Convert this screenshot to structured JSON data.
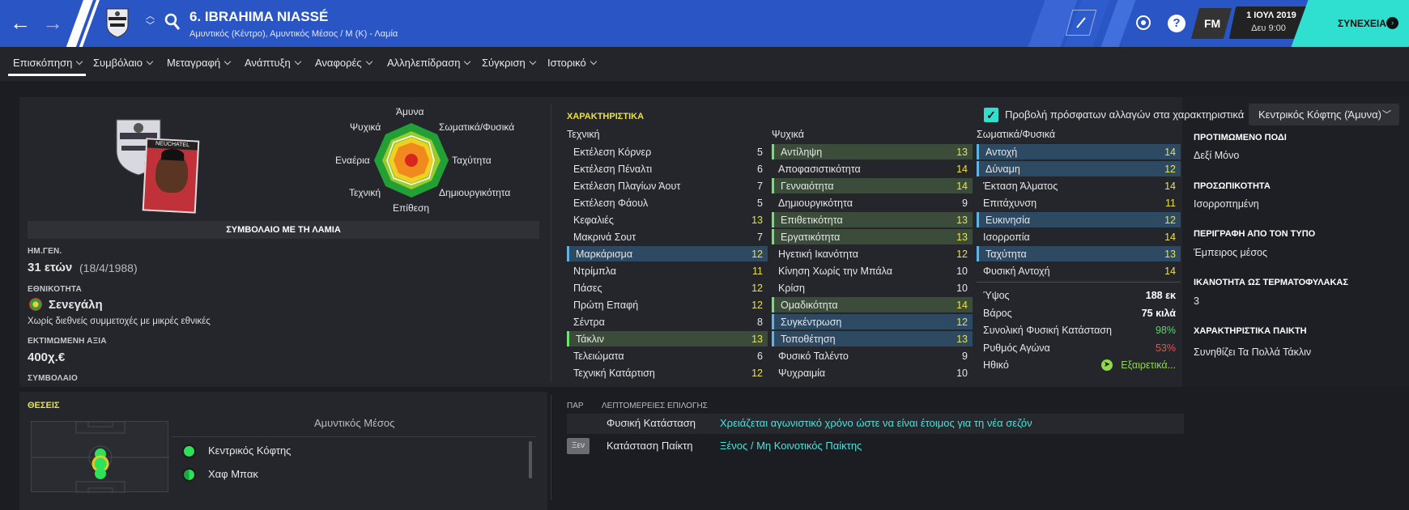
{
  "header": {
    "title": "6. IBRAHIMA NIASSÉ",
    "subtitle": "Αμυντικός (Κέντρο), Αμυντικός Μέσος / Μ (Κ) - Λαμία",
    "fm_label": "FM",
    "date": "1 ΙΟΥΛ 2019",
    "time": "Δευ 9:00",
    "continue_label": "ΣΥΝΕΧΕΙΑ"
  },
  "menu": [
    "Επισκόπηση",
    "Συμβόλαιο",
    "Μεταγραφή",
    "Ανάπτυξη",
    "Αναφορές",
    "Αλληλεπίδραση",
    "Σύγκριση",
    "Ιστορικό"
  ],
  "profile": {
    "radar_labels": {
      "top": "Άμυνα",
      "top_left": "Ψυχικά",
      "top_right": "Σωματικά/Φυσικά",
      "left": "Εναέρια",
      "right": "Ταχύτητα",
      "bottom_left": "Τεχνική",
      "bottom_right": "Δημιουργικότητα",
      "bottom": "Επίθεση"
    },
    "badge_text": "NEUCHATEL",
    "contract_banner": "ΣΥΜΒΟΛΑΙΟ ΜΕ ΤΗ ΛΑΜΙΑ",
    "dob_label": "ΗΜ.ΓΕΝ.",
    "age": "31 ετών",
    "dob": "(18/4/1988)",
    "nationality_label": "ΕΘΝΙΚΟΤΗΤΑ",
    "nationality": "Σενεγάλη",
    "intl_note": "Χωρίς διεθνείς συμμετοχές με μικρές εθνικές",
    "value_label": "ΕΚΤΙΜΩΜΕΝΗ ΑΞΙΑ",
    "value": "400χ.€",
    "contract_label": "ΣΥΜΒΟΛΑΙΟ"
  },
  "attributes": {
    "heading": "ΧΑΡΑΚΤΗΡΙΣΤΙΚΑ",
    "show_changes_label": "Προβολή πρόσφατων αλλαγών στα χαρακτηριστικά",
    "role_select": "Κεντρικός Κόφτης (Άμυνα)",
    "technical_header": "Τεχνική",
    "mental_header": "Ψυχικά",
    "physical_header": "Σωματικά/Φυσικά",
    "technical": [
      {
        "name": "Εκτέλεση Κόρνερ",
        "value": "5",
        "hl": ""
      },
      {
        "name": "Εκτέλεση Πέναλτι",
        "value": "6",
        "hl": ""
      },
      {
        "name": "Εκτέλεση Πλαγίων Άουτ",
        "value": "7",
        "hl": ""
      },
      {
        "name": "Εκτέλεση Φάουλ",
        "value": "5",
        "hl": ""
      },
      {
        "name": "Κεφαλιές",
        "value": "13",
        "hl": ""
      },
      {
        "name": "Μακρινά Σουτ",
        "value": "7",
        "hl": ""
      },
      {
        "name": "Μαρκάρισμα",
        "value": "12",
        "hl": "blue"
      },
      {
        "name": "Ντρίμπλα",
        "value": "11",
        "hl": ""
      },
      {
        "name": "Πάσες",
        "value": "12",
        "hl": ""
      },
      {
        "name": "Πρώτη Επαφή",
        "value": "12",
        "hl": ""
      },
      {
        "name": "Σέντρα",
        "value": "8",
        "hl": ""
      },
      {
        "name": "Τάκλιν",
        "value": "13",
        "hl": "green"
      },
      {
        "name": "Τελειώματα",
        "value": "6",
        "hl": ""
      },
      {
        "name": "Τεχνική Κατάρτιση",
        "value": "12",
        "hl": ""
      }
    ],
    "mental": [
      {
        "name": "Αντίληψη",
        "value": "13",
        "hl": "green"
      },
      {
        "name": "Αποφασιστικότητα",
        "value": "14",
        "hl": ""
      },
      {
        "name": "Γενναιότητα",
        "value": "14",
        "hl": "green"
      },
      {
        "name": "Δημιουργικότητα",
        "value": "9",
        "hl": ""
      },
      {
        "name": "Επιθετικότητα",
        "value": "13",
        "hl": "green"
      },
      {
        "name": "Εργατικότητα",
        "value": "13",
        "hl": "green"
      },
      {
        "name": "Ηγετική Ικανότητα",
        "value": "12",
        "hl": ""
      },
      {
        "name": "Κίνηση Χωρίς την Μπάλα",
        "value": "10",
        "hl": ""
      },
      {
        "name": "Κρίση",
        "value": "10",
        "hl": ""
      },
      {
        "name": "Ομαδικότητα",
        "value": "14",
        "hl": "green"
      },
      {
        "name": "Συγκέντρωση",
        "value": "12",
        "hl": "blue"
      },
      {
        "name": "Τοποθέτηση",
        "value": "13",
        "hl": "blue"
      },
      {
        "name": "Φυσικό Ταλέντο",
        "value": "9",
        "hl": ""
      },
      {
        "name": "Ψυχραιμία",
        "value": "10",
        "hl": ""
      }
    ],
    "physical": [
      {
        "name": "Αντοχή",
        "value": "14",
        "hl": "blue"
      },
      {
        "name": "Δύναμη",
        "value": "12",
        "hl": "blue"
      },
      {
        "name": "Έκταση Άλματος",
        "value": "14",
        "hl": ""
      },
      {
        "name": "Επιτάχυνση",
        "value": "11",
        "hl": ""
      },
      {
        "name": "Ευκινησία",
        "value": "12",
        "hl": "blue"
      },
      {
        "name": "Ισορροπία",
        "value": "14",
        "hl": ""
      },
      {
        "name": "Ταχύτητα",
        "value": "13",
        "hl": "blue"
      },
      {
        "name": "Φυσική Αντοχή",
        "value": "14",
        "hl": ""
      }
    ],
    "extras": [
      {
        "name": "Ύψος",
        "value": "188 εκ",
        "color": "#ffffff"
      },
      {
        "name": "Βάρος",
        "value": "75 κιλά",
        "color": "#ffffff"
      },
      {
        "name": "Συνολική Φυσική Κατάσταση",
        "value": "98%",
        "color": "#5fd36a"
      },
      {
        "name": "Ρυθμός Αγώνα",
        "value": "53%",
        "color": "#e0584a"
      },
      {
        "name": "Ηθικό",
        "value": "Εξαιρετικά...",
        "color": "#8fd94a"
      }
    ]
  },
  "side": {
    "foot_label": "ΠΡΟΤΙΜΩΜΕΝΟ ΠΟΔΙ",
    "foot": "Δεξί Μόνο",
    "personality_label": "ΠΡΟΣΩΠΙΚΟΤΗΤΑ",
    "personality": "Ισορροπημένη",
    "media_label": "ΠΕΡΙΓΡΑΦΗ ΑΠΟ ΤΟΝ ΤΥΠΟ",
    "media": "Έμπειρος μέσος",
    "gk_label": "ΙΚΑΝΟΤΗΤΑ ΩΣ ΤΕΡΜΑΤΟΦΥΛΑΚΑΣ",
    "gk": "3",
    "traits_label": "ΧΑΡΑΚΤΗΡΙΣΤΙΚΑ ΠΑΙΚΤΗ",
    "traits": "Συνηθίζει Τα Πολλά Τάκλιν"
  },
  "positions": {
    "heading": "ΘΕΣΕΙΣ",
    "role_header": "Αμυντικός Μέσος",
    "roles": [
      "Κεντρικός Κόφτης",
      "Χαφ Μπακ"
    ]
  },
  "selection": {
    "par_label": "ΠΑΡ",
    "details_label": "ΛΕΠΤΟΜΕΡΕΙΕΣ ΕΠΙΛΟΓΗΣ",
    "rows": [
      {
        "badge": "",
        "name": "Φυσική Κατάσταση",
        "value": "Χρειάζεται αγωνιστικό χρόνο ώστε να είναι έτοιμος για τη νέα σεζόν"
      },
      {
        "badge": "Ξεν",
        "name": "Κατάσταση Παίκτη",
        "value": "Ξένος / Μη Κοινοτικός Παίκτης"
      }
    ]
  },
  "colors": {
    "header_blue": "#2a55c4",
    "accent_yellow": "#e8e14c",
    "continue_teal": "#2fe0d0",
    "link_teal": "#4fe0d6"
  }
}
